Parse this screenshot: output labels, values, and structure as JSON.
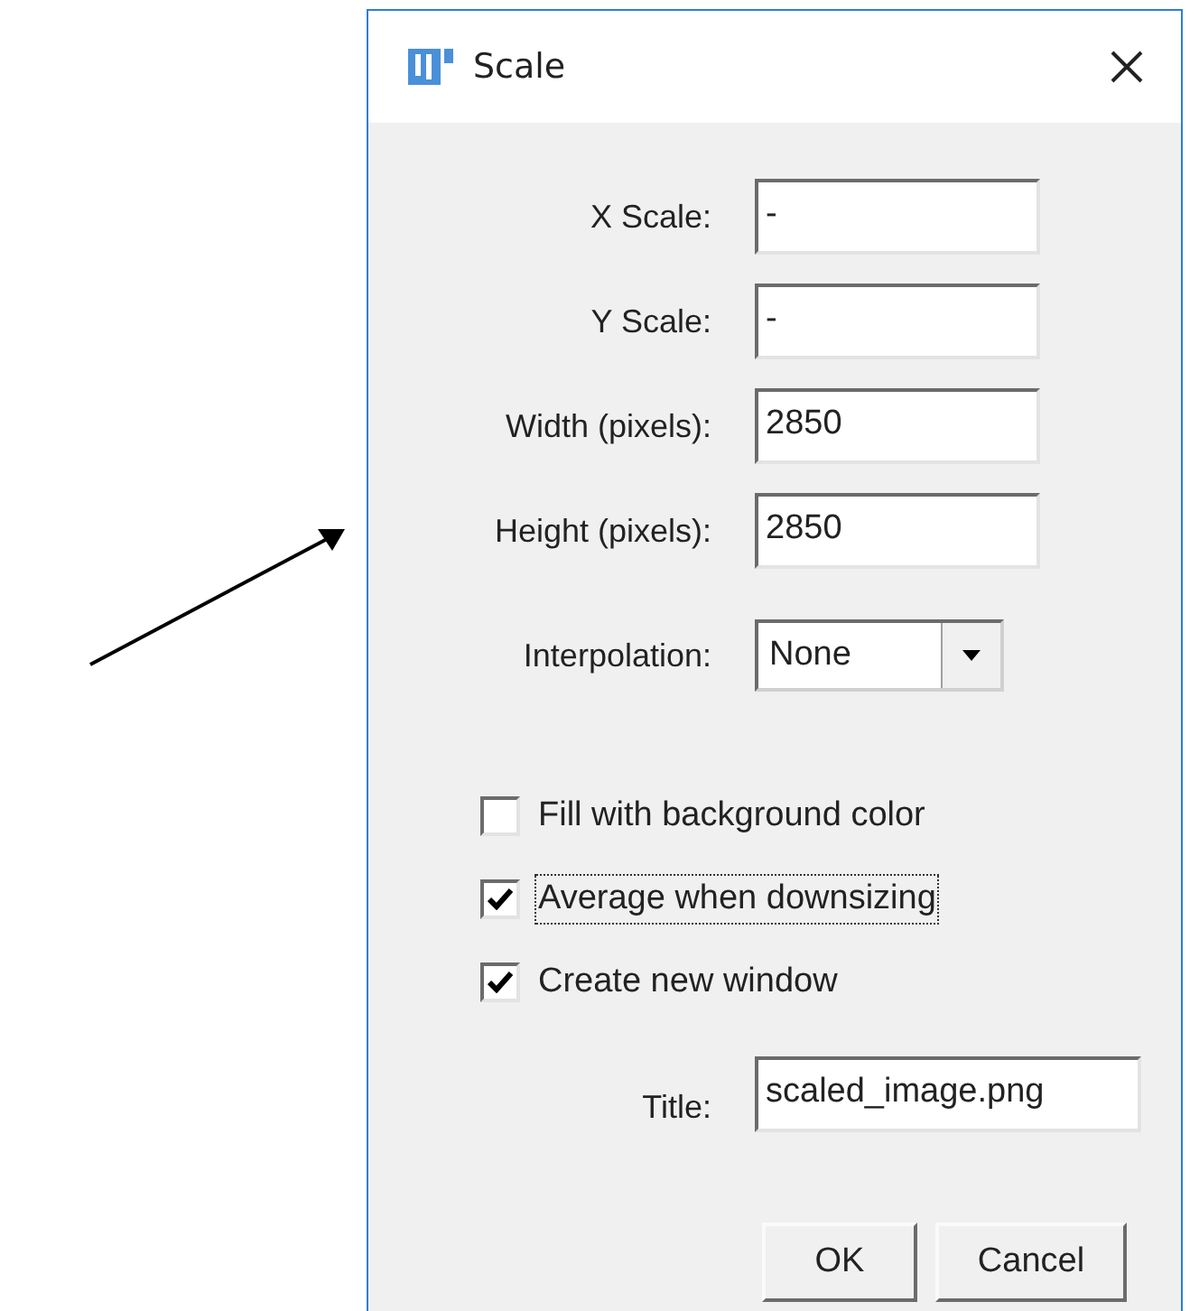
{
  "window": {
    "title": "Scale"
  },
  "fields": [
    {
      "label": "X Scale:",
      "value": "-"
    },
    {
      "label": "Y Scale:",
      "value": "-"
    },
    {
      "label": "Width (pixels):",
      "value": "2850"
    },
    {
      "label": "Height (pixels):",
      "value": "2850"
    }
  ],
  "interpolation": {
    "label": "Interpolation:",
    "value": "None"
  },
  "options": [
    {
      "label": "Fill with background color",
      "checked": false,
      "focused": false
    },
    {
      "label": "Average when downsizing",
      "checked": true,
      "focused": true
    },
    {
      "label": "Create new window",
      "checked": true,
      "focused": false
    }
  ],
  "title_field": {
    "label": "Title:",
    "value": "scaled_image.png"
  },
  "buttons": [
    "OK",
    "Cancel"
  ]
}
